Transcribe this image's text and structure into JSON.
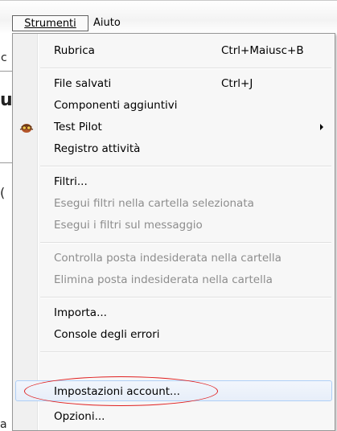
{
  "menubar": {
    "menus": [
      {
        "label": "Strumenti",
        "active": true
      },
      {
        "label": "Aiuto",
        "active": false
      }
    ]
  },
  "background_fragments": [
    "c",
    "u",
    "(",
    "a"
  ],
  "dropdown": {
    "items": [
      {
        "label": "Rubrica",
        "shortcut": "Ctrl+Maiusc+B",
        "enabled": true
      },
      {
        "label": "File salvati",
        "shortcut": "Ctrl+J",
        "enabled": true
      },
      {
        "label": "Componenti aggiuntivi",
        "shortcut": "",
        "enabled": true
      },
      {
        "label": "Test Pilot",
        "shortcut": "",
        "enabled": true,
        "submenu": true,
        "icon": "test-pilot-icon"
      },
      {
        "label": "Registro attività",
        "shortcut": "",
        "enabled": true
      },
      {
        "label": "Filtri...",
        "shortcut": "",
        "enabled": true
      },
      {
        "label": "Esegui filtri nella cartella selezionata",
        "shortcut": "",
        "enabled": false
      },
      {
        "label": "Esegui i filtri sul messaggio",
        "shortcut": "",
        "enabled": false
      },
      {
        "label": "Controlla posta indesiderata nella cartella",
        "shortcut": "",
        "enabled": false
      },
      {
        "label": "Elimina posta indesiderata nella cartella",
        "shortcut": "",
        "enabled": false
      },
      {
        "label": "Importa...",
        "shortcut": "",
        "enabled": true
      },
      {
        "label": "Console degli errori",
        "shortcut": "",
        "enabled": true
      },
      {
        "label": "Impostazioni account...",
        "shortcut": "",
        "enabled": true,
        "highlighted": true
      },
      {
        "label": "Opzioni...",
        "shortcut": "",
        "enabled": true
      }
    ]
  },
  "colors": {
    "highlight_ellipse": "#e02020",
    "hover_border": "#aecff7",
    "disabled_text": "#8d8d8d"
  }
}
